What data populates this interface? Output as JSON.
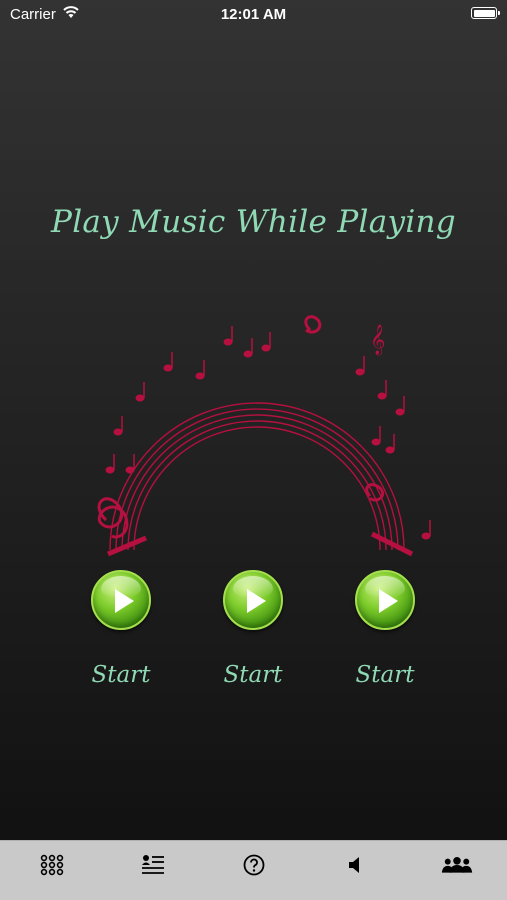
{
  "status_bar": {
    "carrier": "Carrier",
    "time": "12:01 AM"
  },
  "main": {
    "title": "Play Music While Playing",
    "players": [
      {
        "label": "Start"
      },
      {
        "label": "Start"
      },
      {
        "label": "Start"
      }
    ]
  },
  "tab_bar": {
    "icons": [
      "grid-icon",
      "list-icon",
      "help-icon",
      "speaker-icon",
      "group-icon"
    ]
  },
  "colors": {
    "title_text": "#8fd9b4",
    "staff_red": "#b5103f",
    "play_green": "#7ccb2a",
    "tab_bar_bg": "#c9c9c9"
  }
}
